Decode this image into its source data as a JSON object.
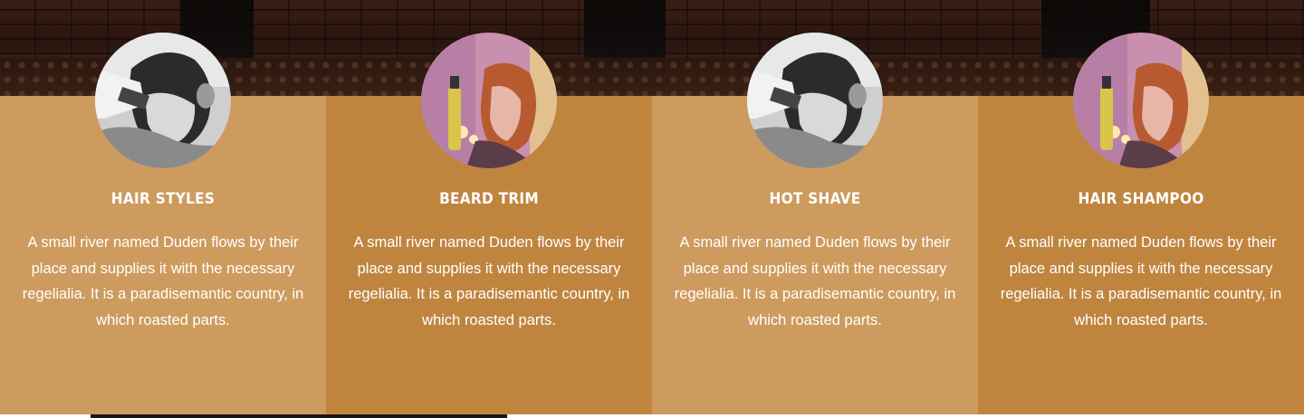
{
  "colors": {
    "card_light": "#cd9b5e",
    "card_dark": "#bf853f",
    "text": "#ffffff"
  },
  "services": [
    {
      "title": "HAIR STYLES",
      "description": "A small river named Duden flows by their place and supplies it with the necessary regelialia. It is a paradisemantic country, in which roasted parts.",
      "image_icon": "bearded-man-grooming-photo"
    },
    {
      "title": "BEARD TRIM",
      "description": "A small river named Duden flows by their place and supplies it with the necessary regelialia. It is a paradisemantic country, in which roasted parts.",
      "image_icon": "woman-hairspray-photo"
    },
    {
      "title": "HOT SHAVE",
      "description": "A small river named Duden flows by their place and supplies it with the necessary regelialia. It is a paradisemantic country, in which roasted parts.",
      "image_icon": "bearded-man-grooming-photo"
    },
    {
      "title": "HAIR SHAMPOO",
      "description": "A small river named Duden flows by their place and supplies it with the necessary regelialia. It is a paradisemantic country, in which roasted parts.",
      "image_icon": "woman-hairspray-photo"
    }
  ]
}
